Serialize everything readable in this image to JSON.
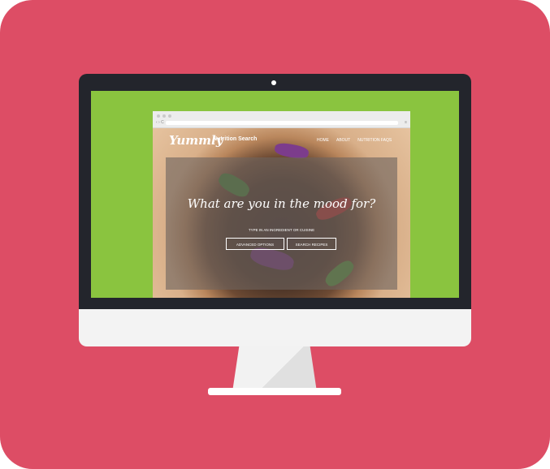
{
  "site": {
    "logo": "Yummly",
    "subtitle": "Nutrition Search",
    "nav": [
      "HOME",
      "ABOUT",
      "NUTRITION FAQS"
    ]
  },
  "hero": {
    "headline": "What are you in the mood for?",
    "hint": "TYPE IN AN INGREDIENT OR CUISINE",
    "advanced_button": "ADVANCED OPTIONS",
    "search_button": "SEARCH RECIPES"
  },
  "browser_chrome": {
    "back_forward": "‹ › C",
    "menu": "≡"
  },
  "colors": {
    "background": "#dd4d65",
    "screen_wallpaper": "#8ac43f",
    "monitor_bezel": "#23252c"
  }
}
